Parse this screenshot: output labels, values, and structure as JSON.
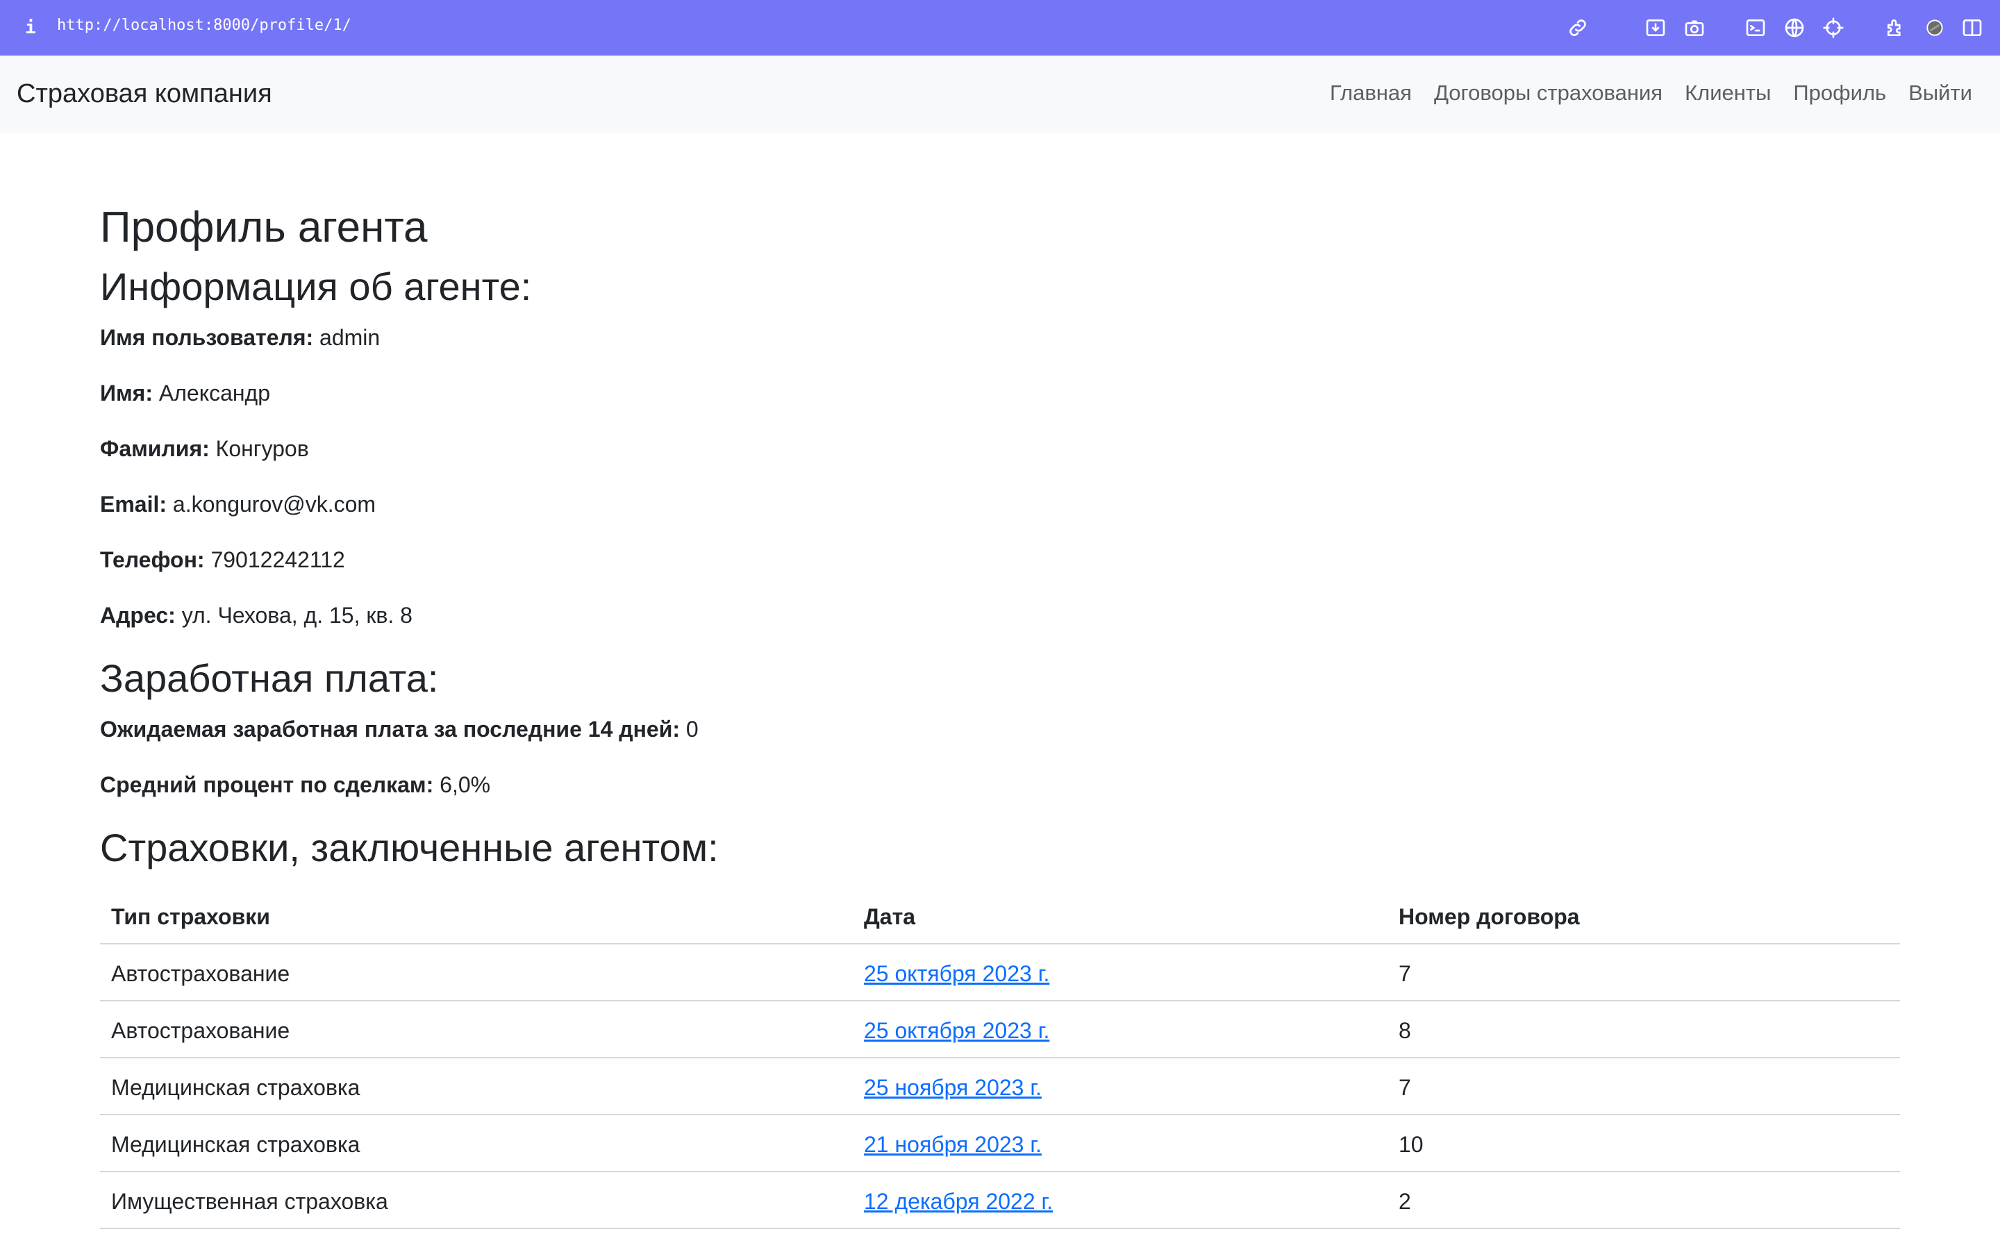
{
  "browser": {
    "url": "http://localhost:8000/profile/1/",
    "info_icon": "i"
  },
  "navbar": {
    "brand": "Страховая компания",
    "links": [
      {
        "label": "Главная"
      },
      {
        "label": "Договоры страхования"
      },
      {
        "label": "Клиенты"
      },
      {
        "label": "Профиль"
      },
      {
        "label": "Выйти"
      }
    ]
  },
  "page": {
    "title": "Профиль агента",
    "info_heading": "Информация об агенте:",
    "fields": [
      {
        "label": "Имя пользователя:",
        "value": "admin"
      },
      {
        "label": "Имя:",
        "value": "Александр"
      },
      {
        "label": "Фамилия:",
        "value": "Конгуров"
      },
      {
        "label": "Email:",
        "value": "a.kongurov@vk.com"
      },
      {
        "label": "Телефон:",
        "value": "79012242112"
      },
      {
        "label": "Адрес:",
        "value": "ул. Чехова, д. 15, кв. 8"
      }
    ],
    "salary_heading": "Заработная плата:",
    "salary_fields": [
      {
        "label": "Ожидаемая заработная плата за последние 14 дней:",
        "value": "0"
      },
      {
        "label": "Средний процент по сделкам:",
        "value": "6,0%"
      }
    ],
    "policies_heading": "Страховки, заключенные агентом:"
  },
  "table": {
    "headers": [
      "Тип страховки",
      "Дата",
      "Номер договора"
    ],
    "rows": [
      {
        "type": "Автострахование",
        "date": "25 октября 2023 г.",
        "number": "7"
      },
      {
        "type": "Автострахование",
        "date": "25 октября 2023 г.",
        "number": "8"
      },
      {
        "type": "Медицинская страховка",
        "date": "25 ноября 2023 г.",
        "number": "7"
      },
      {
        "type": "Медицинская страховка",
        "date": "21 ноября 2023 г.",
        "number": "10"
      },
      {
        "type": "Имущественная страховка",
        "date": "12 декабря 2022 г.",
        "number": "2"
      }
    ]
  },
  "colors": {
    "browser_bar": "#7475f7",
    "navbar_bg": "#f8f9fa",
    "link": "#0d6efd"
  },
  "icons": [
    "link-icon",
    "download-icon",
    "camera-icon",
    "terminal-icon",
    "globe-icon",
    "crosshair-icon",
    "extensions-icon",
    "profile-circle-icon",
    "sidebar-icon"
  ]
}
